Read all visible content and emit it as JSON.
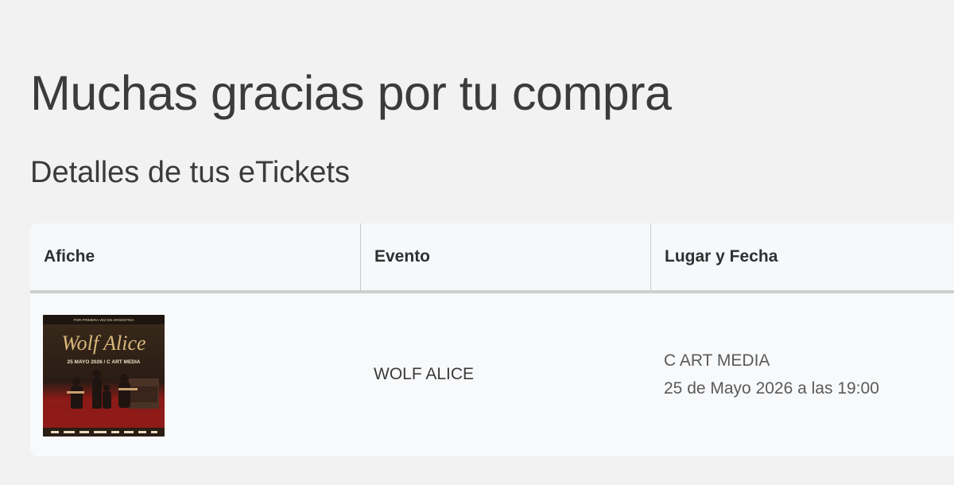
{
  "page": {
    "title": "Muchas gracias por tu compra",
    "subtitle": "Detalles de tus eTickets"
  },
  "table": {
    "headers": [
      "Afiche",
      "Evento",
      "Lugar y Fecha"
    ],
    "rows": [
      {
        "poster": {
          "top_text": "POR PRIMERA VEZ EN ARGENTINA",
          "logo_text": "Wolf Alice",
          "date_text": "25 MAYO 2026 / C ART MEDIA"
        },
        "event": "WOLF ALICE",
        "venue": "C ART MEDIA",
        "datetime": "25 de Mayo 2026 a las 19:00"
      }
    ]
  },
  "colors": {
    "background": "#f2f2f2",
    "card": "#f8f9fb",
    "header_border": "#cfcfcf",
    "poster_red": "#8e1b17",
    "poster_dark": "#2a1c14",
    "poster_gold": "#d8b87a"
  }
}
